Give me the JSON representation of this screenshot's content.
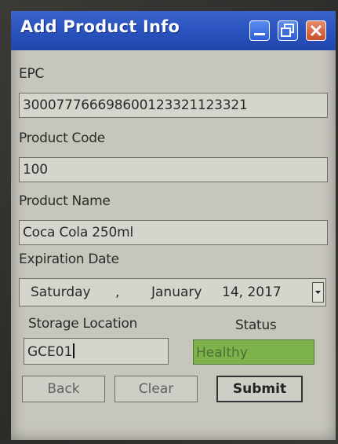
{
  "window": {
    "title": "Add Product Info"
  },
  "form": {
    "epc": {
      "label": "EPC",
      "value": "300077766698600123321123321"
    },
    "product_code": {
      "label": "Product Code",
      "value": "100"
    },
    "product_name": {
      "label": "Product Name",
      "value": "Coca Cola 250ml"
    },
    "expiration_date": {
      "label": "Expiration Date",
      "weekday": "Saturday",
      "sep": ",",
      "month": "January",
      "day_year": "14, 2017"
    },
    "storage_location": {
      "label": "Storage Location",
      "value": "GCE01"
    },
    "status": {
      "label": "Status",
      "value": "Healthy",
      "color": "#7eb24a"
    }
  },
  "buttons": {
    "back": "Back",
    "clear": "Clear",
    "submit": "Submit"
  },
  "icons": {
    "minimize": "minimize-icon",
    "maximize": "restore-icon",
    "close": "close-icon",
    "dropdown": "chevron-down-icon"
  },
  "colors": {
    "titlebar": "#2b54c0",
    "close_button": "#c9502c",
    "status_ok": "#7eb24a"
  }
}
